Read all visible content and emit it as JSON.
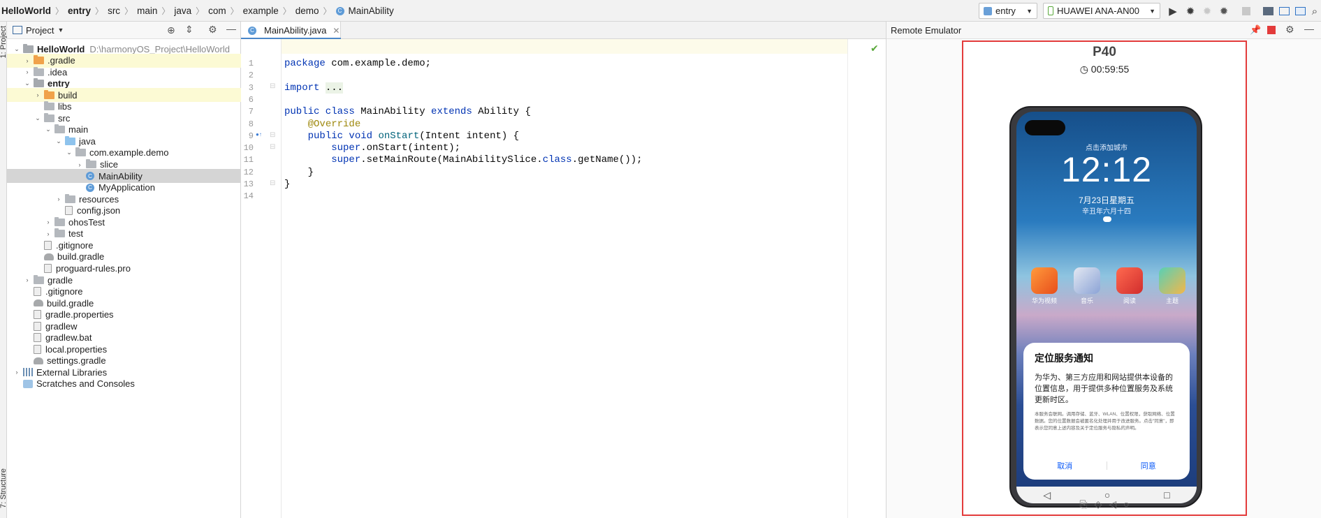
{
  "breadcrumb": [
    "HelloWorld",
    "entry",
    "src",
    "main",
    "java",
    "com",
    "example",
    "demo",
    "MainAbility"
  ],
  "toolbar": {
    "module": "entry",
    "device": "HUAWEI ANA-AN00"
  },
  "side_tabs": {
    "project": "1: Project",
    "structure": "7: Structure"
  },
  "project": {
    "title": "Project",
    "tree": [
      {
        "label": "HelloWorld",
        "path": "D:\\harmonyOS_Project\\HelloWorld",
        "depth": 0,
        "icon": "folder-module",
        "expanded": true,
        "bold": true
      },
      {
        "label": ".gradle",
        "depth": 1,
        "icon": "folder-orange",
        "expanded": false,
        "hl": true
      },
      {
        "label": ".idea",
        "depth": 1,
        "icon": "folder-gray",
        "expanded": false
      },
      {
        "label": "entry",
        "depth": 1,
        "icon": "folder-module",
        "expanded": true,
        "bold": true
      },
      {
        "label": "build",
        "depth": 2,
        "icon": "folder-orange",
        "expanded": false,
        "hl": true
      },
      {
        "label": "libs",
        "depth": 2,
        "icon": "folder-gray",
        "leaf": true
      },
      {
        "label": "src",
        "depth": 2,
        "icon": "folder-gray",
        "expanded": true
      },
      {
        "label": "main",
        "depth": 3,
        "icon": "folder-gray",
        "expanded": true
      },
      {
        "label": "java",
        "depth": 4,
        "icon": "folder-blue",
        "expanded": true
      },
      {
        "label": "com.example.demo",
        "depth": 5,
        "icon": "folder-gray",
        "expanded": true
      },
      {
        "label": "slice",
        "depth": 6,
        "icon": "folder-gray",
        "expanded": false
      },
      {
        "label": "MainAbility",
        "depth": 6,
        "icon": "class",
        "leaf": true,
        "sel": true
      },
      {
        "label": "MyApplication",
        "depth": 6,
        "icon": "class",
        "leaf": true
      },
      {
        "label": "resources",
        "depth": 4,
        "icon": "folder-gray",
        "expanded": false
      },
      {
        "label": "config.json",
        "depth": 4,
        "icon": "file",
        "leaf": true
      },
      {
        "label": "ohosTest",
        "depth": 3,
        "icon": "folder-gray",
        "expanded": false
      },
      {
        "label": "test",
        "depth": 3,
        "icon": "folder-gray",
        "expanded": false
      },
      {
        "label": ".gitignore",
        "depth": 2,
        "icon": "file",
        "leaf": true
      },
      {
        "label": "build.gradle",
        "depth": 2,
        "icon": "gradle",
        "leaf": true
      },
      {
        "label": "proguard-rules.pro",
        "depth": 2,
        "icon": "file",
        "leaf": true
      },
      {
        "label": "gradle",
        "depth": 1,
        "icon": "folder-gray",
        "expanded": false
      },
      {
        "label": ".gitignore",
        "depth": 1,
        "icon": "file",
        "leaf": true
      },
      {
        "label": "build.gradle",
        "depth": 1,
        "icon": "gradle",
        "leaf": true
      },
      {
        "label": "gradle.properties",
        "depth": 1,
        "icon": "file",
        "leaf": true
      },
      {
        "label": "gradlew",
        "depth": 1,
        "icon": "file",
        "leaf": true
      },
      {
        "label": "gradlew.bat",
        "depth": 1,
        "icon": "file",
        "leaf": true
      },
      {
        "label": "local.properties",
        "depth": 1,
        "icon": "file",
        "leaf": true
      },
      {
        "label": "settings.gradle",
        "depth": 1,
        "icon": "gradle",
        "leaf": true
      },
      {
        "label": "External Libraries",
        "depth": 0,
        "icon": "library",
        "expanded": false
      },
      {
        "label": "Scratches and Consoles",
        "depth": 0,
        "icon": "scratch",
        "leaf": true
      }
    ]
  },
  "editor": {
    "tab": "MainAbility.java",
    "lines": [
      {
        "n": "1",
        "html": "<span class='kw'>package</span> com.example.demo;"
      },
      {
        "n": "2",
        "html": ""
      },
      {
        "n": "3",
        "html": "<span class='kw'>import</span> <span style='background:#ebf3e6'>...</span>"
      },
      {
        "n": "6",
        "html": ""
      },
      {
        "n": "7",
        "html": "<span class='kw'>public class</span> MainAbility <span class='kw'>extends</span> Ability {"
      },
      {
        "n": "8",
        "html": "    <span class='an'>@Override</span>"
      },
      {
        "n": "9",
        "html": "    <span class='kw'>public void</span> <span style='color:#00627a'>onStart</span>(Intent intent) {"
      },
      {
        "n": "10",
        "html": "        <span class='kw'>super</span>.onStart(intent);"
      },
      {
        "n": "11",
        "html": "        <span class='kw'>super</span>.setMainRoute(MainAbilitySlice.<span class='kw'>class</span>.getName());"
      },
      {
        "n": "12",
        "html": "    }"
      },
      {
        "n": "13",
        "html": "}"
      },
      {
        "n": "14",
        "html": ""
      }
    ]
  },
  "emulator": {
    "title": "Remote Emulator",
    "device_name": "P40",
    "timer": "00:59:55",
    "lock_hint": "点击添加城市",
    "clock": "12:12",
    "date": "7月23日星期五",
    "lunar": "辛丑年六月十四",
    "apps": [
      "华为视频",
      "音乐",
      "阅读",
      "主题"
    ],
    "dialog": {
      "title": "定位服务通知",
      "body": "为华为、第三方应用和网站提供本设备的位置信息，用于提供多种位置服务及系统更新时区。",
      "fine": "本服务会联网。调用存储、蓝牙、WLAN、位置权限，获取网络、位置数据。您的位置数据会被匿名化处理并用于改进服务。点击\"同意\"，即表示您同意上述内容及关于定位服务与隐私的声明。",
      "cancel": "取消",
      "agree": "同意"
    }
  }
}
